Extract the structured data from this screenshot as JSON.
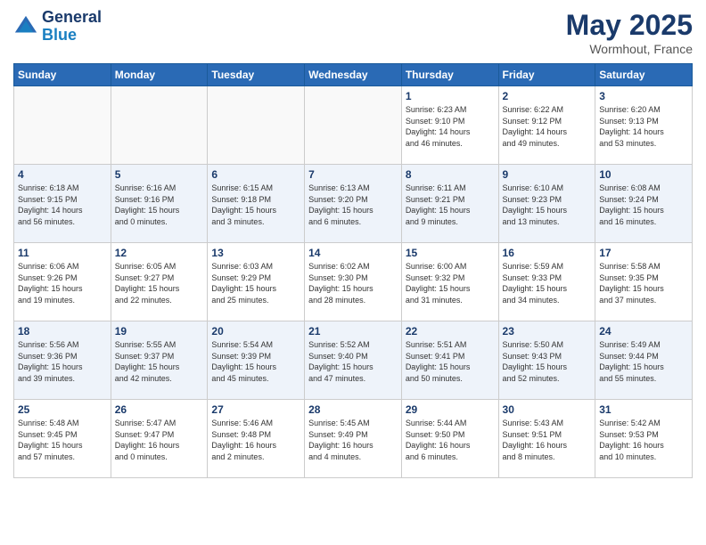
{
  "header": {
    "logo_line1": "General",
    "logo_line2": "Blue",
    "month_year": "May 2025",
    "location": "Wormhout, France"
  },
  "weekdays": [
    "Sunday",
    "Monday",
    "Tuesday",
    "Wednesday",
    "Thursday",
    "Friday",
    "Saturday"
  ],
  "weeks": [
    [
      {
        "day": "",
        "info": ""
      },
      {
        "day": "",
        "info": ""
      },
      {
        "day": "",
        "info": ""
      },
      {
        "day": "",
        "info": ""
      },
      {
        "day": "1",
        "info": "Sunrise: 6:23 AM\nSunset: 9:10 PM\nDaylight: 14 hours\nand 46 minutes."
      },
      {
        "day": "2",
        "info": "Sunrise: 6:22 AM\nSunset: 9:12 PM\nDaylight: 14 hours\nand 49 minutes."
      },
      {
        "day": "3",
        "info": "Sunrise: 6:20 AM\nSunset: 9:13 PM\nDaylight: 14 hours\nand 53 minutes."
      }
    ],
    [
      {
        "day": "4",
        "info": "Sunrise: 6:18 AM\nSunset: 9:15 PM\nDaylight: 14 hours\nand 56 minutes."
      },
      {
        "day": "5",
        "info": "Sunrise: 6:16 AM\nSunset: 9:16 PM\nDaylight: 15 hours\nand 0 minutes."
      },
      {
        "day": "6",
        "info": "Sunrise: 6:15 AM\nSunset: 9:18 PM\nDaylight: 15 hours\nand 3 minutes."
      },
      {
        "day": "7",
        "info": "Sunrise: 6:13 AM\nSunset: 9:20 PM\nDaylight: 15 hours\nand 6 minutes."
      },
      {
        "day": "8",
        "info": "Sunrise: 6:11 AM\nSunset: 9:21 PM\nDaylight: 15 hours\nand 9 minutes."
      },
      {
        "day": "9",
        "info": "Sunrise: 6:10 AM\nSunset: 9:23 PM\nDaylight: 15 hours\nand 13 minutes."
      },
      {
        "day": "10",
        "info": "Sunrise: 6:08 AM\nSunset: 9:24 PM\nDaylight: 15 hours\nand 16 minutes."
      }
    ],
    [
      {
        "day": "11",
        "info": "Sunrise: 6:06 AM\nSunset: 9:26 PM\nDaylight: 15 hours\nand 19 minutes."
      },
      {
        "day": "12",
        "info": "Sunrise: 6:05 AM\nSunset: 9:27 PM\nDaylight: 15 hours\nand 22 minutes."
      },
      {
        "day": "13",
        "info": "Sunrise: 6:03 AM\nSunset: 9:29 PM\nDaylight: 15 hours\nand 25 minutes."
      },
      {
        "day": "14",
        "info": "Sunrise: 6:02 AM\nSunset: 9:30 PM\nDaylight: 15 hours\nand 28 minutes."
      },
      {
        "day": "15",
        "info": "Sunrise: 6:00 AM\nSunset: 9:32 PM\nDaylight: 15 hours\nand 31 minutes."
      },
      {
        "day": "16",
        "info": "Sunrise: 5:59 AM\nSunset: 9:33 PM\nDaylight: 15 hours\nand 34 minutes."
      },
      {
        "day": "17",
        "info": "Sunrise: 5:58 AM\nSunset: 9:35 PM\nDaylight: 15 hours\nand 37 minutes."
      }
    ],
    [
      {
        "day": "18",
        "info": "Sunrise: 5:56 AM\nSunset: 9:36 PM\nDaylight: 15 hours\nand 39 minutes."
      },
      {
        "day": "19",
        "info": "Sunrise: 5:55 AM\nSunset: 9:37 PM\nDaylight: 15 hours\nand 42 minutes."
      },
      {
        "day": "20",
        "info": "Sunrise: 5:54 AM\nSunset: 9:39 PM\nDaylight: 15 hours\nand 45 minutes."
      },
      {
        "day": "21",
        "info": "Sunrise: 5:52 AM\nSunset: 9:40 PM\nDaylight: 15 hours\nand 47 minutes."
      },
      {
        "day": "22",
        "info": "Sunrise: 5:51 AM\nSunset: 9:41 PM\nDaylight: 15 hours\nand 50 minutes."
      },
      {
        "day": "23",
        "info": "Sunrise: 5:50 AM\nSunset: 9:43 PM\nDaylight: 15 hours\nand 52 minutes."
      },
      {
        "day": "24",
        "info": "Sunrise: 5:49 AM\nSunset: 9:44 PM\nDaylight: 15 hours\nand 55 minutes."
      }
    ],
    [
      {
        "day": "25",
        "info": "Sunrise: 5:48 AM\nSunset: 9:45 PM\nDaylight: 15 hours\nand 57 minutes."
      },
      {
        "day": "26",
        "info": "Sunrise: 5:47 AM\nSunset: 9:47 PM\nDaylight: 16 hours\nand 0 minutes."
      },
      {
        "day": "27",
        "info": "Sunrise: 5:46 AM\nSunset: 9:48 PM\nDaylight: 16 hours\nand 2 minutes."
      },
      {
        "day": "28",
        "info": "Sunrise: 5:45 AM\nSunset: 9:49 PM\nDaylight: 16 hours\nand 4 minutes."
      },
      {
        "day": "29",
        "info": "Sunrise: 5:44 AM\nSunset: 9:50 PM\nDaylight: 16 hours\nand 6 minutes."
      },
      {
        "day": "30",
        "info": "Sunrise: 5:43 AM\nSunset: 9:51 PM\nDaylight: 16 hours\nand 8 minutes."
      },
      {
        "day": "31",
        "info": "Sunrise: 5:42 AM\nSunset: 9:53 PM\nDaylight: 16 hours\nand 10 minutes."
      }
    ]
  ]
}
